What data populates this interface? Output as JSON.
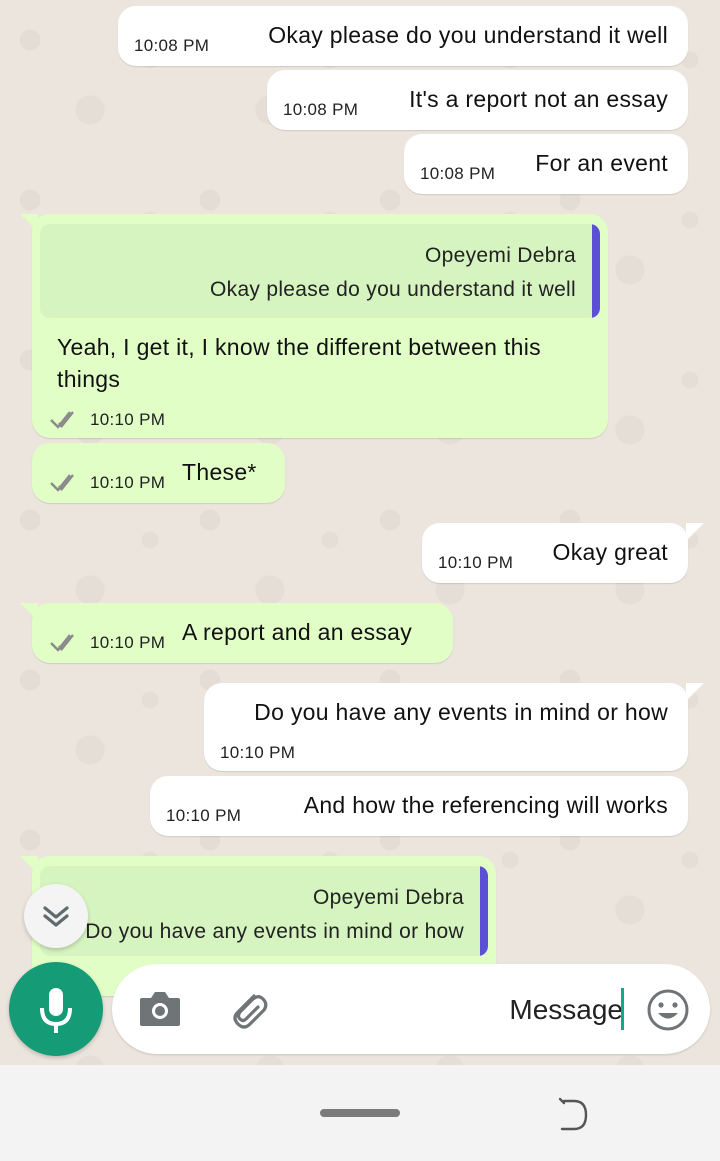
{
  "contact_name": "Opeyemi Debra",
  "messages": [
    {
      "side": "in",
      "text": "Okay please do you understand it well",
      "time": "10:08 PM"
    },
    {
      "side": "in",
      "text": "It's a report not an essay",
      "time": "10:08 PM"
    },
    {
      "side": "in",
      "text": "For an event",
      "time": "10:08 PM"
    },
    {
      "side": "out",
      "quote_author": "Opeyemi Debra",
      "quote_text": "Okay please do you understand it well",
      "text_line1": "Yeah, I get it, I know the different between this",
      "text_line2": "things",
      "time": "10:10 PM"
    },
    {
      "side": "out",
      "text": "These*",
      "time": "10:10 PM"
    },
    {
      "side": "in",
      "text": "Okay great",
      "time": "10:10 PM"
    },
    {
      "side": "out",
      "text": "A report and an essay",
      "time": "10:10 PM"
    },
    {
      "side": "in",
      "text": "Do you have any events in mind or how",
      "time": "10:10 PM"
    },
    {
      "side": "in",
      "text": "And how the referencing will works",
      "time": "10:10 PM"
    },
    {
      "side": "out",
      "quote_author": "Opeyemi Debra",
      "quote_text": "Do you have any events in mind or how"
    }
  ],
  "composer": {
    "placeholder": "Message"
  },
  "icons": {
    "mic": "microphone-icon",
    "camera": "camera-icon",
    "attach": "paperclip-icon",
    "emoji": "emoji-icon",
    "scroll": "double-chevron-down-icon",
    "read": "double-check-icon"
  },
  "colors": {
    "accent": "#159b76",
    "outgoing_bubble": "#e1fec6",
    "incoming_bubble": "#ffffff",
    "quote_bar": "#5b4fd6"
  }
}
